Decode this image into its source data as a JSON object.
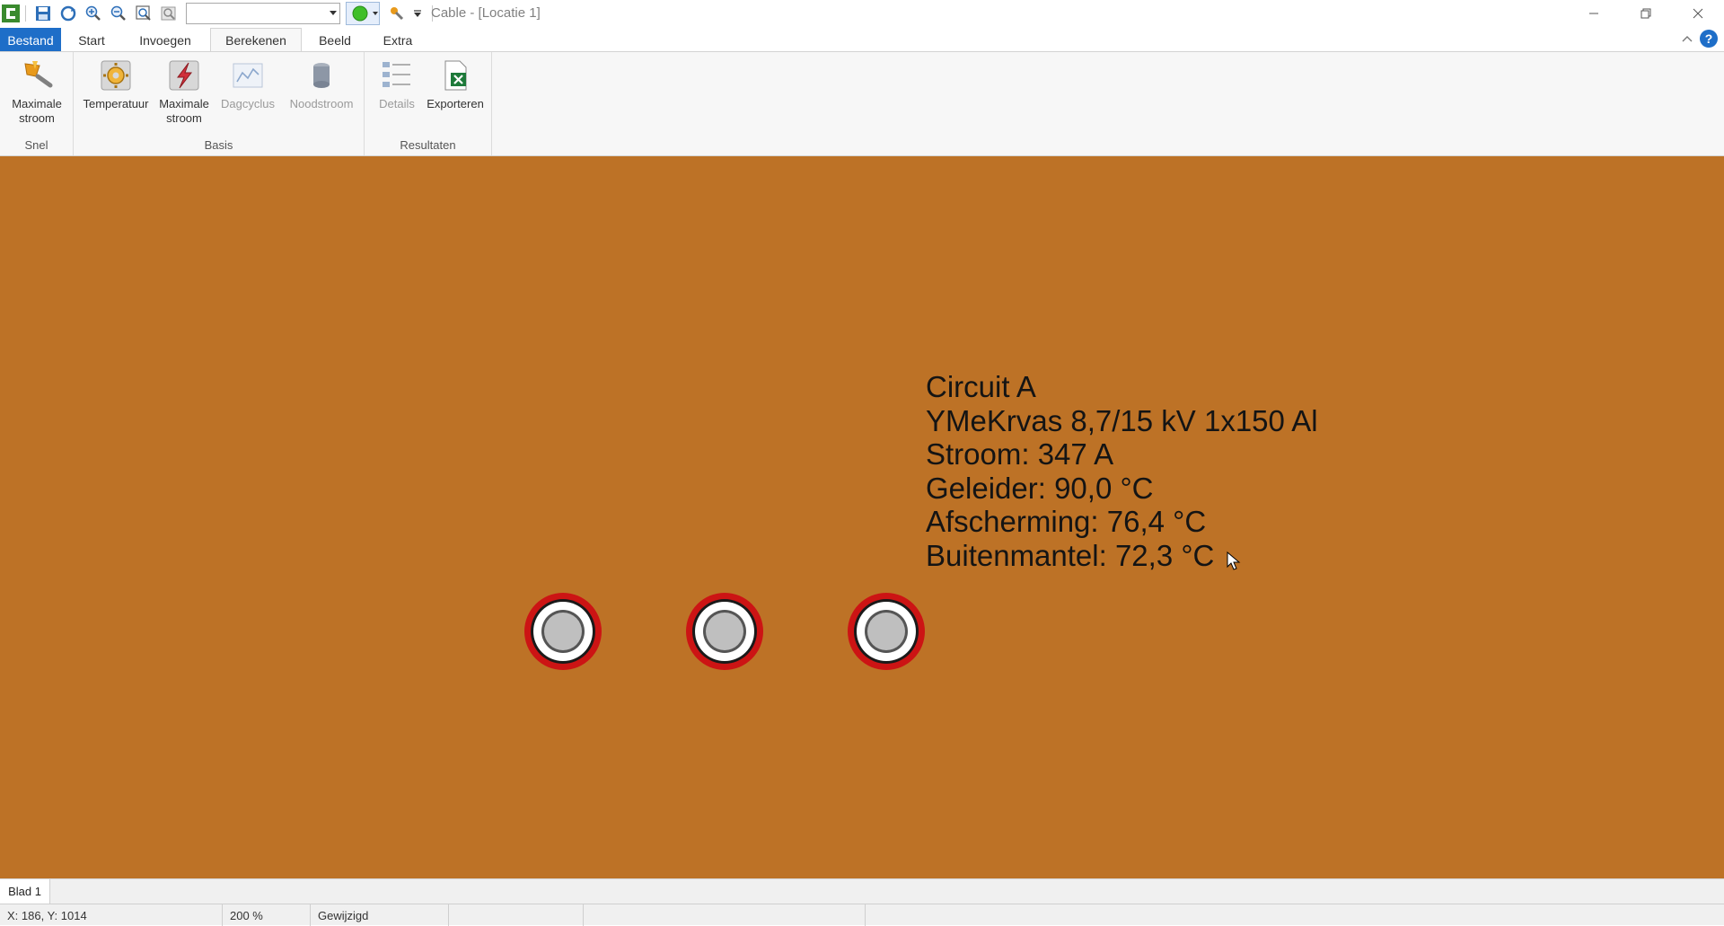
{
  "window": {
    "title": "Cable - [Locatie 1]"
  },
  "qat": {
    "combo_value": ""
  },
  "tabs": [
    {
      "label": "Bestand"
    },
    {
      "label": "Start"
    },
    {
      "label": "Invoegen"
    },
    {
      "label": "Berekenen"
    },
    {
      "label": "Beeld"
    },
    {
      "label": "Extra"
    }
  ],
  "active_tab": "Berekenen",
  "ribbon": {
    "groups": {
      "snel": "Snel",
      "basis": "Basis",
      "resultaten": "Resultaten"
    },
    "buttons": {
      "maximale_stroom_snel": "Maximale\nstroom",
      "temperatuur": "Temperatuur",
      "maximale_stroom": "Maximale\nstroom",
      "dagcyclus": "Dagcyclus",
      "noodstroom": "Noodstroom",
      "details": "Details",
      "exporteren": "Exporteren"
    }
  },
  "canvas": {
    "background": "#bd7226",
    "info": [
      "Circuit A",
      "YMeKrvas 8,7/15 kV 1x150 Al",
      "Stroom: 347 A",
      "Geleider: 90,0 °C",
      "Afscherming: 76,4 °C",
      "Buitenmantel: 72,3 °C"
    ]
  },
  "sheets": {
    "active": "Blad 1"
  },
  "status": {
    "coords": "X: 186, Y: 1014",
    "zoom": "200 %",
    "state": "Gewijzigd"
  },
  "colors": {
    "accent": "#1e6ec8",
    "cable_outer": "#cc1414",
    "cable_conductor": "#bfbfbf"
  }
}
